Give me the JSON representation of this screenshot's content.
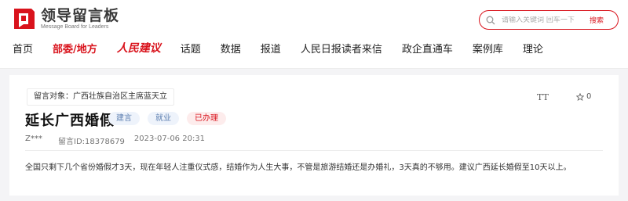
{
  "header": {
    "logo_title": "领导留言板",
    "logo_subtitle": "Message Board for Leaders",
    "search_placeholder": "请输入关键词 回车一下",
    "search_button": "搜索",
    "brand_color": "#d9131c"
  },
  "nav": {
    "items": [
      {
        "label": "首页"
      },
      {
        "label": "部委/地方"
      },
      {
        "label": "人民建议"
      },
      {
        "label": "话题"
      },
      {
        "label": "数据"
      },
      {
        "label": "报道"
      },
      {
        "label": "人民日报读者来信"
      },
      {
        "label": "政企直通车"
      },
      {
        "label": "案例库"
      },
      {
        "label": "理论"
      }
    ],
    "active_index": 1
  },
  "message": {
    "target_label": "留言对象：广西壮族自治区主席蓝天立",
    "title": "延长广西婚假",
    "badges": [
      "建言",
      "就业",
      "已办理"
    ],
    "author": "Z***",
    "id_text": "留言ID:18378679",
    "datetime": "2023-07-06 20:31",
    "body": "全国只剩下几个省份婚假才3天，现在年轻人注重仪式感，结婚作为人生大事，不管是旅游结婚还是办婚礼，3天真的不够用。建议广西延长婚假至10天以上。",
    "font_toggle": "TT",
    "like_count": "0"
  },
  "icons": {
    "logo": "logo-mark-icon",
    "search": "search-icon",
    "like": "star-icon"
  }
}
